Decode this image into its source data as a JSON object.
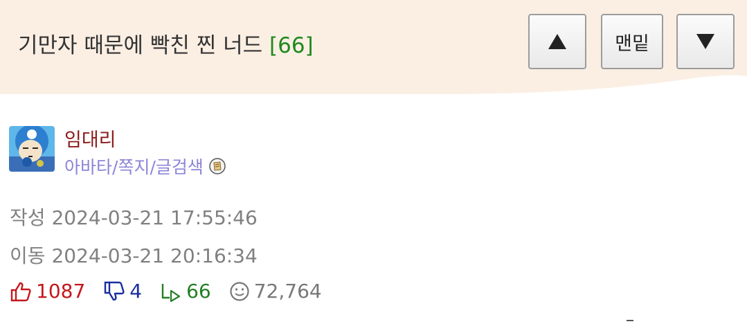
{
  "header": {
    "title": "기만자 때문에 빡친 찐 너드",
    "comment_count": "[66]"
  },
  "nav_buttons": {
    "up_icon": "triangle-up-icon",
    "bottom_label": "맨밑",
    "down_icon": "triangle-down-icon"
  },
  "author": {
    "nickname": "임대리",
    "avatar_link": "아바타",
    "message_link": "쪽지",
    "search_link": "글검색",
    "separator": "/",
    "badge_icon": "level-badge-icon"
  },
  "meta": {
    "created_label": "작성",
    "created_at": "2024-03-21 17:55:46",
    "moved_label": "이동",
    "moved_at": "2024-03-21 20:16:34"
  },
  "stats": {
    "likes": "1087",
    "dislikes": "4",
    "replies": "66",
    "views": "72,764"
  },
  "colors": {
    "header_bg": "#fbefe4",
    "count_green": "#1e8a1e",
    "nickname_red": "#8a1a1a",
    "link_purple": "#8b85d6",
    "like_red": "#c4171d",
    "dislike_blue": "#1a2ea0",
    "reply_green": "#237e23"
  }
}
